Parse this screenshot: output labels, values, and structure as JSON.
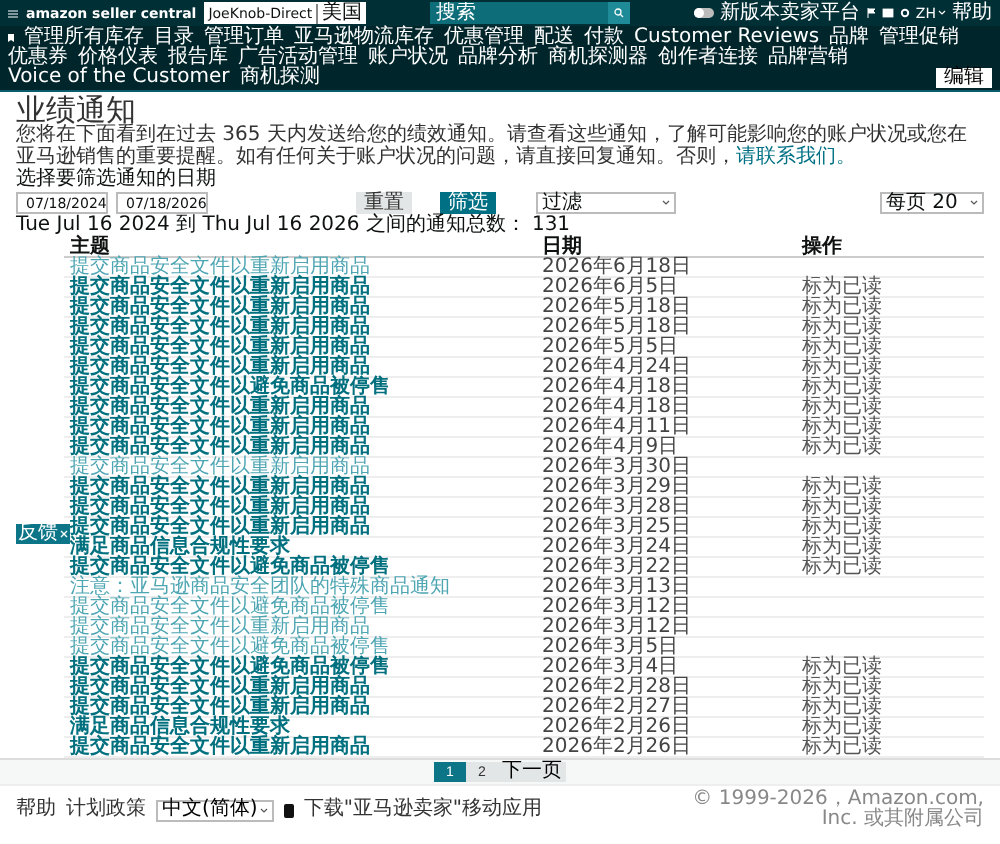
{
  "top_bar": {
    "logo": "amazon seller central",
    "store": "JoeKnob-Direct",
    "region": "美国",
    "search_placeholder": "搜索",
    "toggle": {
      "label": "新版本卖家平台",
      "on": false
    },
    "language": "ZH",
    "help": "帮助"
  },
  "nav": {
    "items": [
      "管理所有库存",
      "目录",
      "管理订单",
      "亚马逊物流库存",
      "优惠管理",
      "配送",
      "付款",
      "Customer Reviews",
      "品牌",
      "管理促销",
      "优惠券",
      "价格仪表",
      "报告库",
      "广告活动管理",
      "账户状况",
      "品牌分析",
      "商机探测器",
      "创作者连接",
      "品牌营销",
      "Voice of the Customer",
      "商机探测"
    ],
    "edit_button": "编辑"
  },
  "page": {
    "title": "业绩通知",
    "description": "您将在下面看到在过去 365 天内发送给您的绩效通知。请查看这些通知，了解可能影响您的账户状况或您在亚马逊销售的重要提醒。如有任何关于账户状况的问题，请直接回复通知。否则，",
    "contact_link": "请联系我们。",
    "filter_label": "选择要筛选通知的日期",
    "date_from": "07/18/2024",
    "date_to": "07/18/2026",
    "reset_button": "重置",
    "filter_button": "筛选",
    "filter_select": "过滤",
    "per_page_select": "每页 20",
    "range_text": "Tue Jul 16 2024 到 Thu Jul 16 2026 之间的通知总数：",
    "range_count": "131"
  },
  "table": {
    "columns": [
      "主题",
      "日期",
      "操作"
    ],
    "rows": [
      {
        "subject": "提交商品安全文件以重新启用商品",
        "date": "2026年6月18日",
        "read": true
      },
      {
        "subject": "提交商品安全文件以重新启用商品",
        "date": "2026年6月5日",
        "read": false,
        "action": "标为已读"
      },
      {
        "subject": "提交商品安全文件以重新启用商品",
        "date": "2026年5月18日",
        "read": false,
        "action": "标为已读"
      },
      {
        "subject": "提交商品安全文件以重新启用商品",
        "date": "2026年5月18日",
        "read": false,
        "action": "标为已读"
      },
      {
        "subject": "提交商品安全文件以重新启用商品",
        "date": "2026年5月5日",
        "read": false,
        "action": "标为已读"
      },
      {
        "subject": "提交商品安全文件以重新启用商品",
        "date": "2026年4月24日",
        "read": false,
        "action": "标为已读"
      },
      {
        "subject": "提交商品安全文件以避免商品被停售",
        "date": "2026年4月18日",
        "read": false,
        "action": "标为已读"
      },
      {
        "subject": "提交商品安全文件以重新启用商品",
        "date": "2026年4月18日",
        "read": false,
        "action": "标为已读"
      },
      {
        "subject": "提交商品安全文件以重新启用商品",
        "date": "2026年4月11日",
        "read": false,
        "action": "标为已读"
      },
      {
        "subject": "提交商品安全文件以重新启用商品",
        "date": "2026年4月9日",
        "read": false,
        "action": "标为已读"
      },
      {
        "subject": "提交商品安全文件以重新启用商品",
        "date": "2026年3月30日",
        "read": true
      },
      {
        "subject": "提交商品安全文件以重新启用商品",
        "date": "2026年3月29日",
        "read": false,
        "action": "标为已读"
      },
      {
        "subject": "提交商品安全文件以重新启用商品",
        "date": "2026年3月28日",
        "read": false,
        "action": "标为已读"
      },
      {
        "subject": "提交商品安全文件以重新启用商品",
        "date": "2026年3月25日",
        "read": false,
        "action": "标为已读"
      },
      {
        "subject": "满足商品信息合规性要求",
        "date": "2026年3月24日",
        "read": false,
        "action": "标为已读"
      },
      {
        "subject": "提交商品安全文件以避免商品被停售",
        "date": "2026年3月22日",
        "read": false,
        "action": "标为已读"
      },
      {
        "subject": "注意：亚马逊商品安全团队的特殊商品通知",
        "date": "2026年3月13日",
        "read": true
      },
      {
        "subject": "提交商品安全文件以避免商品被停售",
        "date": "2026年3月12日",
        "read": true
      },
      {
        "subject": "提交商品安全文件以重新启用商品",
        "date": "2026年3月12日",
        "read": true
      },
      {
        "subject": "提交商品安全文件以避免商品被停售",
        "date": "2026年3月5日",
        "read": true
      },
      {
        "subject": "提交商品安全文件以避免商品被停售",
        "date": "2026年3月4日",
        "read": false,
        "action": "标为已读"
      },
      {
        "subject": "提交商品安全文件以重新启用商品",
        "date": "2026年2月28日",
        "read": false,
        "action": "标为已读"
      },
      {
        "subject": "提交商品安全文件以重新启用商品",
        "date": "2026年2月27日",
        "read": false,
        "action": "标为已读"
      },
      {
        "subject": "满足商品信息合规性要求",
        "date": "2026年2月26日",
        "read": false,
        "action": "标为已读"
      },
      {
        "subject": "提交商品安全文件以重新启用商品",
        "date": "2026年2月26日",
        "read": false,
        "action": "标为已读"
      }
    ]
  },
  "feedback_tab": {
    "label": "反馈"
  },
  "pagination": {
    "pages": [
      {
        "label": "1",
        "selected": true
      },
      {
        "label": "2",
        "selected": false
      }
    ],
    "next": "下一页"
  },
  "footer": {
    "links": [
      "帮助",
      "计划政策"
    ],
    "language": "中文(简体)",
    "app_text": "下载\"亚马逊卖家\"移动应用",
    "copyright": "© 1999-2026，Amazon.com, Inc. 或其附属公司"
  }
}
